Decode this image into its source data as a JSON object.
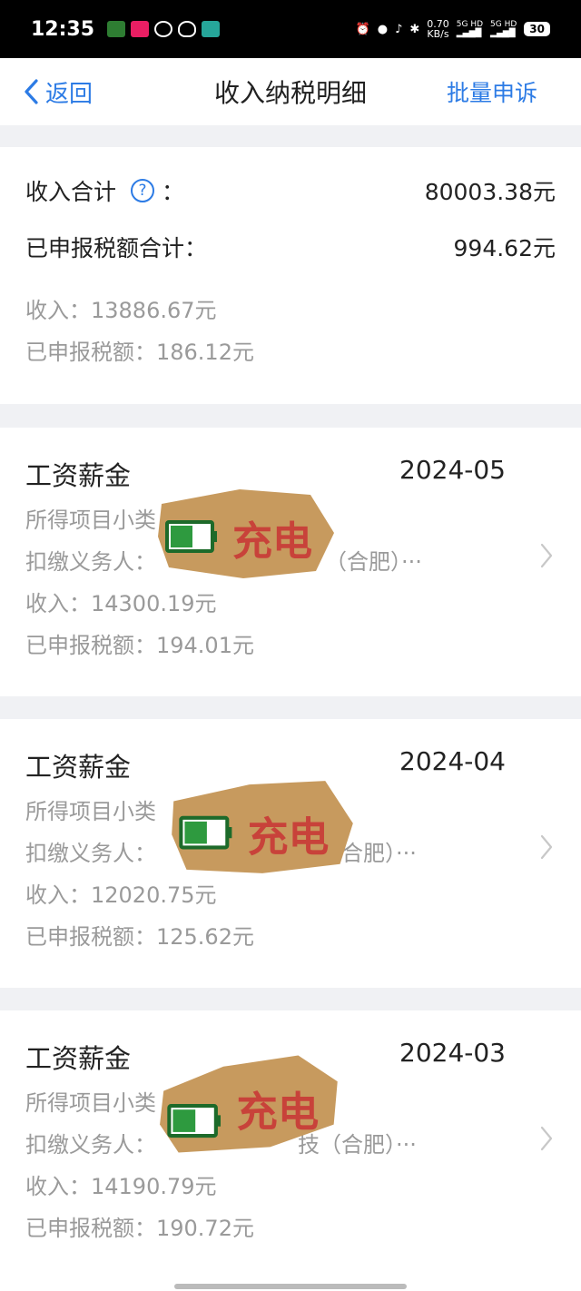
{
  "status_bar": {
    "time": "12:35",
    "speed_value": "0.70",
    "speed_unit": "KB/s",
    "net1": "5G HD",
    "net2": "5G HD",
    "battery": "30"
  },
  "nav": {
    "back_label": "返回",
    "title": "收入纳税明细",
    "appeal_label": "批量申诉"
  },
  "summary": {
    "income_total_label": "收入合计",
    "income_total_colon": "：",
    "income_total_value": "80003.38元",
    "tax_total_label": "已申报税额合计：",
    "tax_total_value": "994.62元",
    "income_line": "收入：13886.67元",
    "tax_line": "已申报税额：186.12元"
  },
  "records": [
    {
      "title": "工资薪金",
      "date": "2024-05",
      "subcategory": "所得项目小类",
      "withholder_prefix": "扣缴义务人：",
      "withholder_suffix": "（合肥）···",
      "income": "收入：14300.19元",
      "tax": "已申报税额：194.01元"
    },
    {
      "title": "工资薪金",
      "date": "2024-04",
      "subcategory": "所得项目小类",
      "withholder_prefix": "扣缴义务人：",
      "withholder_suffix": "合肥）···",
      "income": "收入：12020.75元",
      "tax": "已申报税额：125.62元"
    },
    {
      "title": "工资薪金",
      "date": "2024-03",
      "subcategory": "所得项目小类",
      "withholder_prefix": "扣缴义务人：",
      "withholder_suffix": "技（合肥）···",
      "income": "收入：14190.79元",
      "tax": "已申报税额：190.72元"
    }
  ],
  "sticker": {
    "logo_text": "充电",
    "color": "#c8423a"
  },
  "colors": {
    "accent": "#2c7be5",
    "muted_text": "#9a9a9a",
    "page_bg": "#f0f1f4"
  }
}
